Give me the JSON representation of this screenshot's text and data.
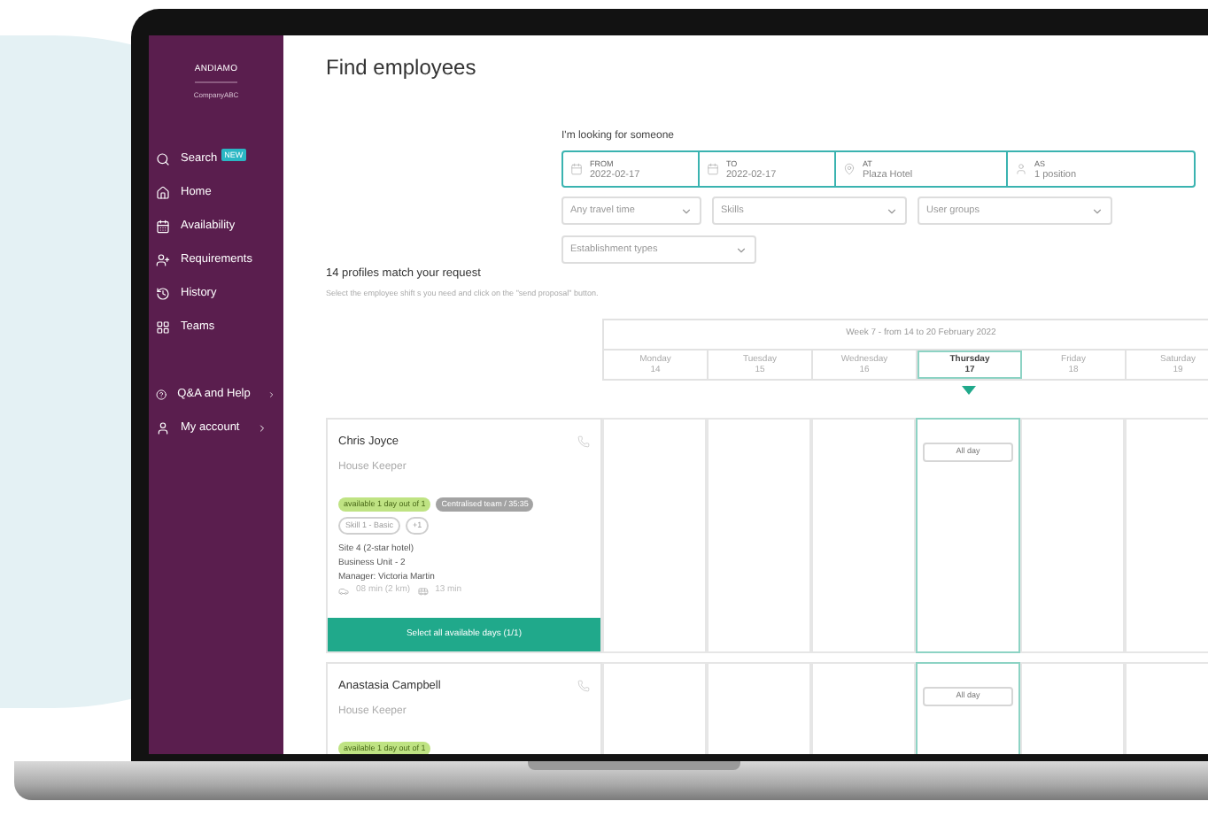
{
  "sidebar": {
    "logo": "ANDIAMO",
    "company": "CompanyABC",
    "items": [
      {
        "label": "Search",
        "badge": "NEW"
      },
      {
        "label": "Home"
      },
      {
        "label": "Availability"
      },
      {
        "label": "Requirements"
      },
      {
        "label": "History"
      },
      {
        "label": "Teams"
      }
    ],
    "bottom_items": [
      {
        "label": "Q&A and Help",
        "has_submenu": true
      },
      {
        "label": "My account",
        "has_submenu": true
      }
    ]
  },
  "page_title": "Find employees",
  "search": {
    "label": "I'm looking for someone",
    "fields": [
      {
        "label": "FROM",
        "value": "2022-02-17"
      },
      {
        "label": "TO",
        "value": "2022-02-17"
      },
      {
        "label": "AT",
        "value": "Plaza Hotel"
      },
      {
        "label": "AS",
        "value": "1 position"
      }
    ],
    "filters": [
      {
        "placeholder": "Any travel time"
      },
      {
        "placeholder": "Skills"
      },
      {
        "placeholder": "User groups"
      },
      {
        "placeholder": "Establishment types"
      }
    ]
  },
  "results": {
    "title": "14 profiles match your request",
    "hint": "Select the employee shift s you need and click on the \"send proposal\" button."
  },
  "calendar": {
    "week_title": "Week 7 - from 14 to 20 February 2022",
    "days": [
      {
        "name": "Monday",
        "date": "14",
        "selected": false
      },
      {
        "name": "Tuesday",
        "date": "15",
        "selected": false
      },
      {
        "name": "Wednesday",
        "date": "16",
        "selected": false
      },
      {
        "name": "Thursday",
        "date": "17",
        "selected": true
      },
      {
        "name": "Friday",
        "date": "18",
        "selected": false
      },
      {
        "name": "Saturday",
        "date": "19",
        "selected": false
      }
    ]
  },
  "employees": [
    {
      "name": "Chris Joyce",
      "role": "House Keeper",
      "tags": [
        {
          "text": "available 1 day out of 1",
          "kind": "availability"
        },
        {
          "text": "Centralised team / 35:35",
          "kind": "team"
        },
        {
          "text": "Skill 1 - Basic",
          "kind": "skill"
        },
        {
          "text": "+1",
          "kind": "skill"
        }
      ],
      "details": [
        "Site 4 (2-star hotel)",
        "Business Unit - 2",
        "Manager: Victoria Martin"
      ],
      "car_time": "08 min (2 km)",
      "transit_time": "13 min",
      "action": "Select all available days (1/1)",
      "shift": "All day"
    },
    {
      "name": "Anastasia Campbell",
      "role": "House Keeper",
      "tags": [
        {
          "text": "available 1 day out of 1",
          "kind": "availability"
        }
      ],
      "shift": "All day"
    }
  ]
}
